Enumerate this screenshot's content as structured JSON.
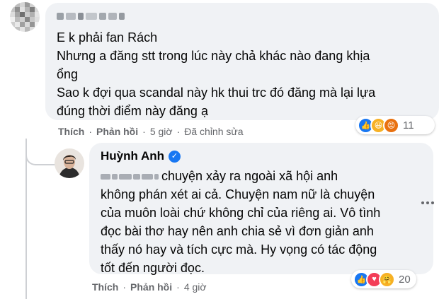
{
  "comment": {
    "body": "E k phải fan Rách\nNhưng a đăng stt trong lúc này chả khác nào đang khịa\nổng\nSao k đợi qua scandal này hk thui trc đó đăng mà lại lựa\nđúng thời điểm này đăng ạ",
    "actions": {
      "like": "Thích",
      "reply": "Phản hồi",
      "time": "5 giờ",
      "edited": "Đã chỉnh sửa",
      "sep": "·"
    },
    "reactions": {
      "count": "11",
      "icons": [
        "like-icon",
        "haha-icon",
        "angry-icon"
      ]
    }
  },
  "reply": {
    "author": "Huỳnh Anh",
    "body": "chuyện xảy ra ngoài xã hội anh\nkhông phán xét ai cả. Chuyện nam nữ là chuyện\ncủa muôn loài chứ không chỉ của riêng ai. Vô tình\nđọc bài thơ hay nên anh chia sẻ vì đơn giản anh\nthấy nó hay và tích cực mà. Hy vọng có tác động\ntốt đến người đọc.",
    "actions": {
      "like": "Thích",
      "reply": "Phản hồi",
      "time": "4 giờ",
      "sep": "·"
    },
    "reactions": {
      "count": "20",
      "icons": [
        "like-icon",
        "love-icon",
        "care-icon"
      ]
    }
  },
  "colors": {
    "bubble": "#f0f2f5",
    "like": "#1877f2",
    "love": "#f33e58",
    "haha": "#f7b125",
    "meta": "#65676b"
  }
}
